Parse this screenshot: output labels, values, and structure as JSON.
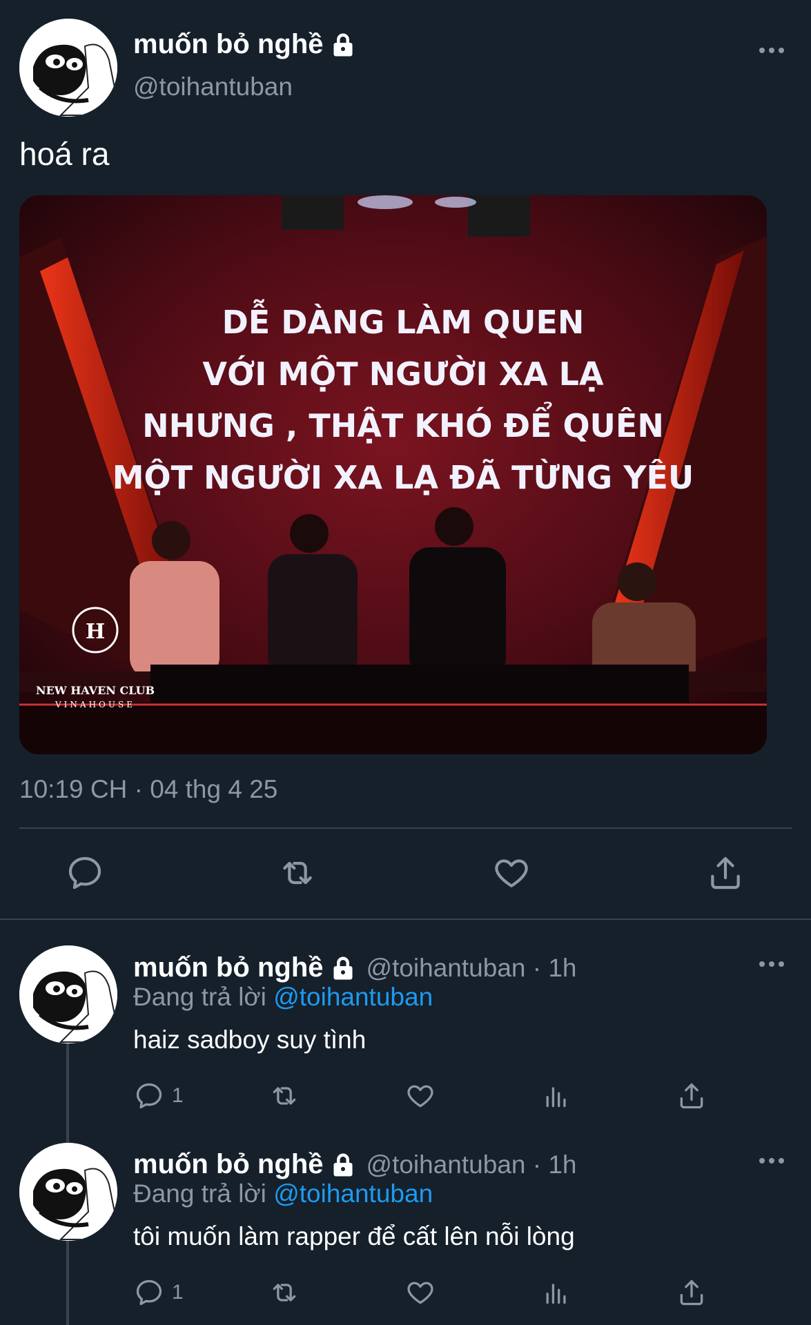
{
  "main_tweet": {
    "author_name": "muốn bỏ nghề",
    "handle": "@toihantuban",
    "text": "hoá ra",
    "media": {
      "screen_lines": [
        "DỄ DÀNG LÀM QUEN",
        "VỚI MỘT NGƯỜI XA LẠ",
        "NHƯNG , THẬT KHÓ ĐỂ QUÊN",
        "MỘT NGƯỜI XA LẠ ĐÃ TỪNG YÊU"
      ],
      "logo_text": "NEW HAVEN CLUB",
      "logo_sub": "VINAHOUSE"
    },
    "timestamp": "10:19 CH · 04 thg 4 25",
    "actions": [
      "reply-icon",
      "retweet-icon",
      "like-icon",
      "share-icon"
    ]
  },
  "replies": [
    {
      "author_name": "muốn bỏ nghề",
      "handle_time": "@toihantuban · 1h",
      "replying_prefix": "Đang trả lời",
      "replying_to": "@toihantuban",
      "text": "haiz sadboy suy tình",
      "reply_count": "1"
    },
    {
      "author_name": "muốn bỏ nghề",
      "handle_time": "@toihantuban · 1h",
      "replying_prefix": "Đang trả lời",
      "replying_to": "@toihantuban",
      "text": "tôi muốn làm rapper để cất lên nỗi lòng",
      "reply_count": "1"
    }
  ],
  "colors": {
    "background": "#15202b",
    "secondary_text": "#8b98a5",
    "mention": "#1d9bf0",
    "divider": "#38444d"
  }
}
